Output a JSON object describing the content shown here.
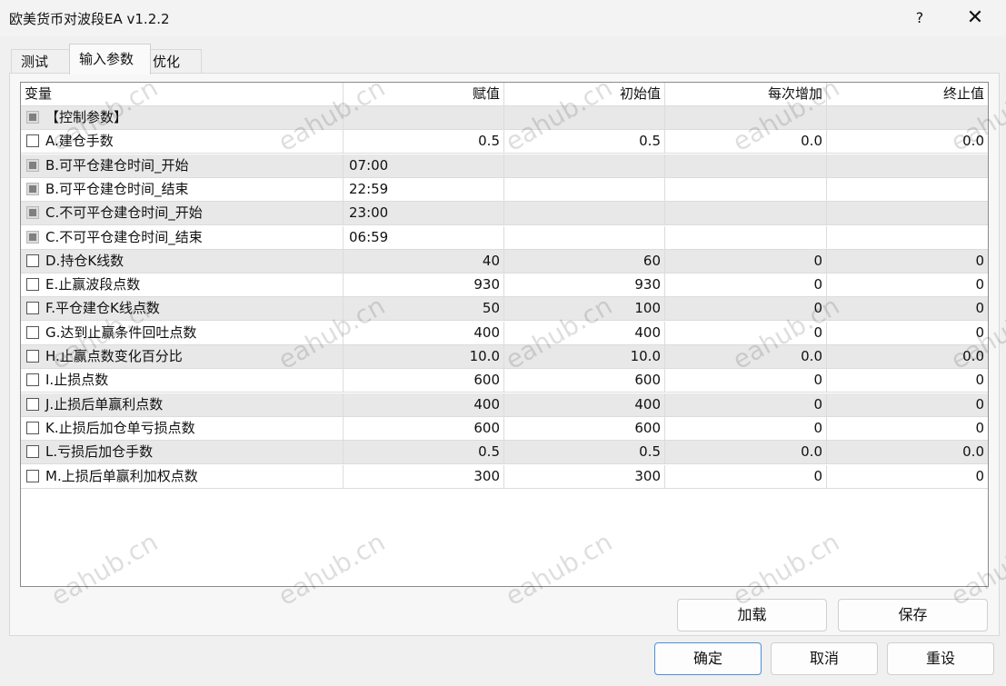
{
  "window": {
    "title": "欧美货币对波段EA v1.2.2",
    "help": "?",
    "close": "✕"
  },
  "tabs": [
    {
      "label": "测试"
    },
    {
      "label": "输入参数"
    },
    {
      "label": "优化"
    }
  ],
  "grid": {
    "columns": [
      "变量",
      "赋值",
      "初始值",
      "每次增加",
      "终止值"
    ],
    "rows": [
      {
        "name": "【控制参数】",
        "value": "",
        "start": "",
        "step": "",
        "stop": "",
        "checkbox": "disabled",
        "shaded": true
      },
      {
        "name": "A.建仓手数",
        "value": "0.5",
        "start": "0.5",
        "step": "0.0",
        "stop": "0.0",
        "checkbox": "enabled",
        "shaded": false
      },
      {
        "name": "B.可平仓建仓时间_开始",
        "value": "07:00",
        "start": "",
        "step": "",
        "stop": "",
        "checkbox": "disabled",
        "shaded": true,
        "align": "left"
      },
      {
        "name": "B.可平仓建仓时间_结束",
        "value": "22:59",
        "start": "",
        "step": "",
        "stop": "",
        "checkbox": "disabled",
        "shaded": false,
        "align": "left"
      },
      {
        "name": "C.不可平仓建仓时间_开始",
        "value": "23:00",
        "start": "",
        "step": "",
        "stop": "",
        "checkbox": "disabled",
        "shaded": true,
        "align": "left"
      },
      {
        "name": "C.不可平仓建仓时间_结束",
        "value": "06:59",
        "start": "",
        "step": "",
        "stop": "",
        "checkbox": "disabled",
        "shaded": false,
        "align": "left"
      },
      {
        "name": "D.持仓K线数",
        "value": "40",
        "start": "60",
        "step": "0",
        "stop": "0",
        "checkbox": "enabled",
        "shaded": true
      },
      {
        "name": "E.止赢波段点数",
        "value": "930",
        "start": "930",
        "step": "0",
        "stop": "0",
        "checkbox": "enabled",
        "shaded": false
      },
      {
        "name": "F.平仓建仓K线点数",
        "value": "50",
        "start": "100",
        "step": "0",
        "stop": "0",
        "checkbox": "enabled",
        "shaded": true
      },
      {
        "name": "G.达到止赢条件回吐点数",
        "value": "400",
        "start": "400",
        "step": "0",
        "stop": "0",
        "checkbox": "enabled",
        "shaded": false
      },
      {
        "name": "H.止赢点数变化百分比",
        "value": "10.0",
        "start": "10.0",
        "step": "0.0",
        "stop": "0.0",
        "checkbox": "enabled",
        "shaded": true
      },
      {
        "name": "I.止损点数",
        "value": "600",
        "start": "600",
        "step": "0",
        "stop": "0",
        "checkbox": "enabled",
        "shaded": false
      },
      {
        "name": "J.止损后单赢利点数",
        "value": "400",
        "start": "400",
        "step": "0",
        "stop": "0",
        "checkbox": "enabled",
        "shaded": true
      },
      {
        "name": "K.止损后加仓单亏损点数",
        "value": "600",
        "start": "600",
        "step": "0",
        "stop": "0",
        "checkbox": "enabled",
        "shaded": false
      },
      {
        "name": "L.亏损后加仓手数",
        "value": "0.5",
        "start": "0.5",
        "step": "0.0",
        "stop": "0.0",
        "checkbox": "enabled",
        "shaded": true
      },
      {
        "name": "M.上损后单赢利加权点数",
        "value": "300",
        "start": "300",
        "step": "0",
        "stop": "0",
        "checkbox": "enabled",
        "shaded": false
      }
    ]
  },
  "buttons": {
    "load": "加载",
    "save": "保存",
    "ok": "确定",
    "cancel": "取消",
    "reset": "重设"
  },
  "watermark": "eahub.cn"
}
